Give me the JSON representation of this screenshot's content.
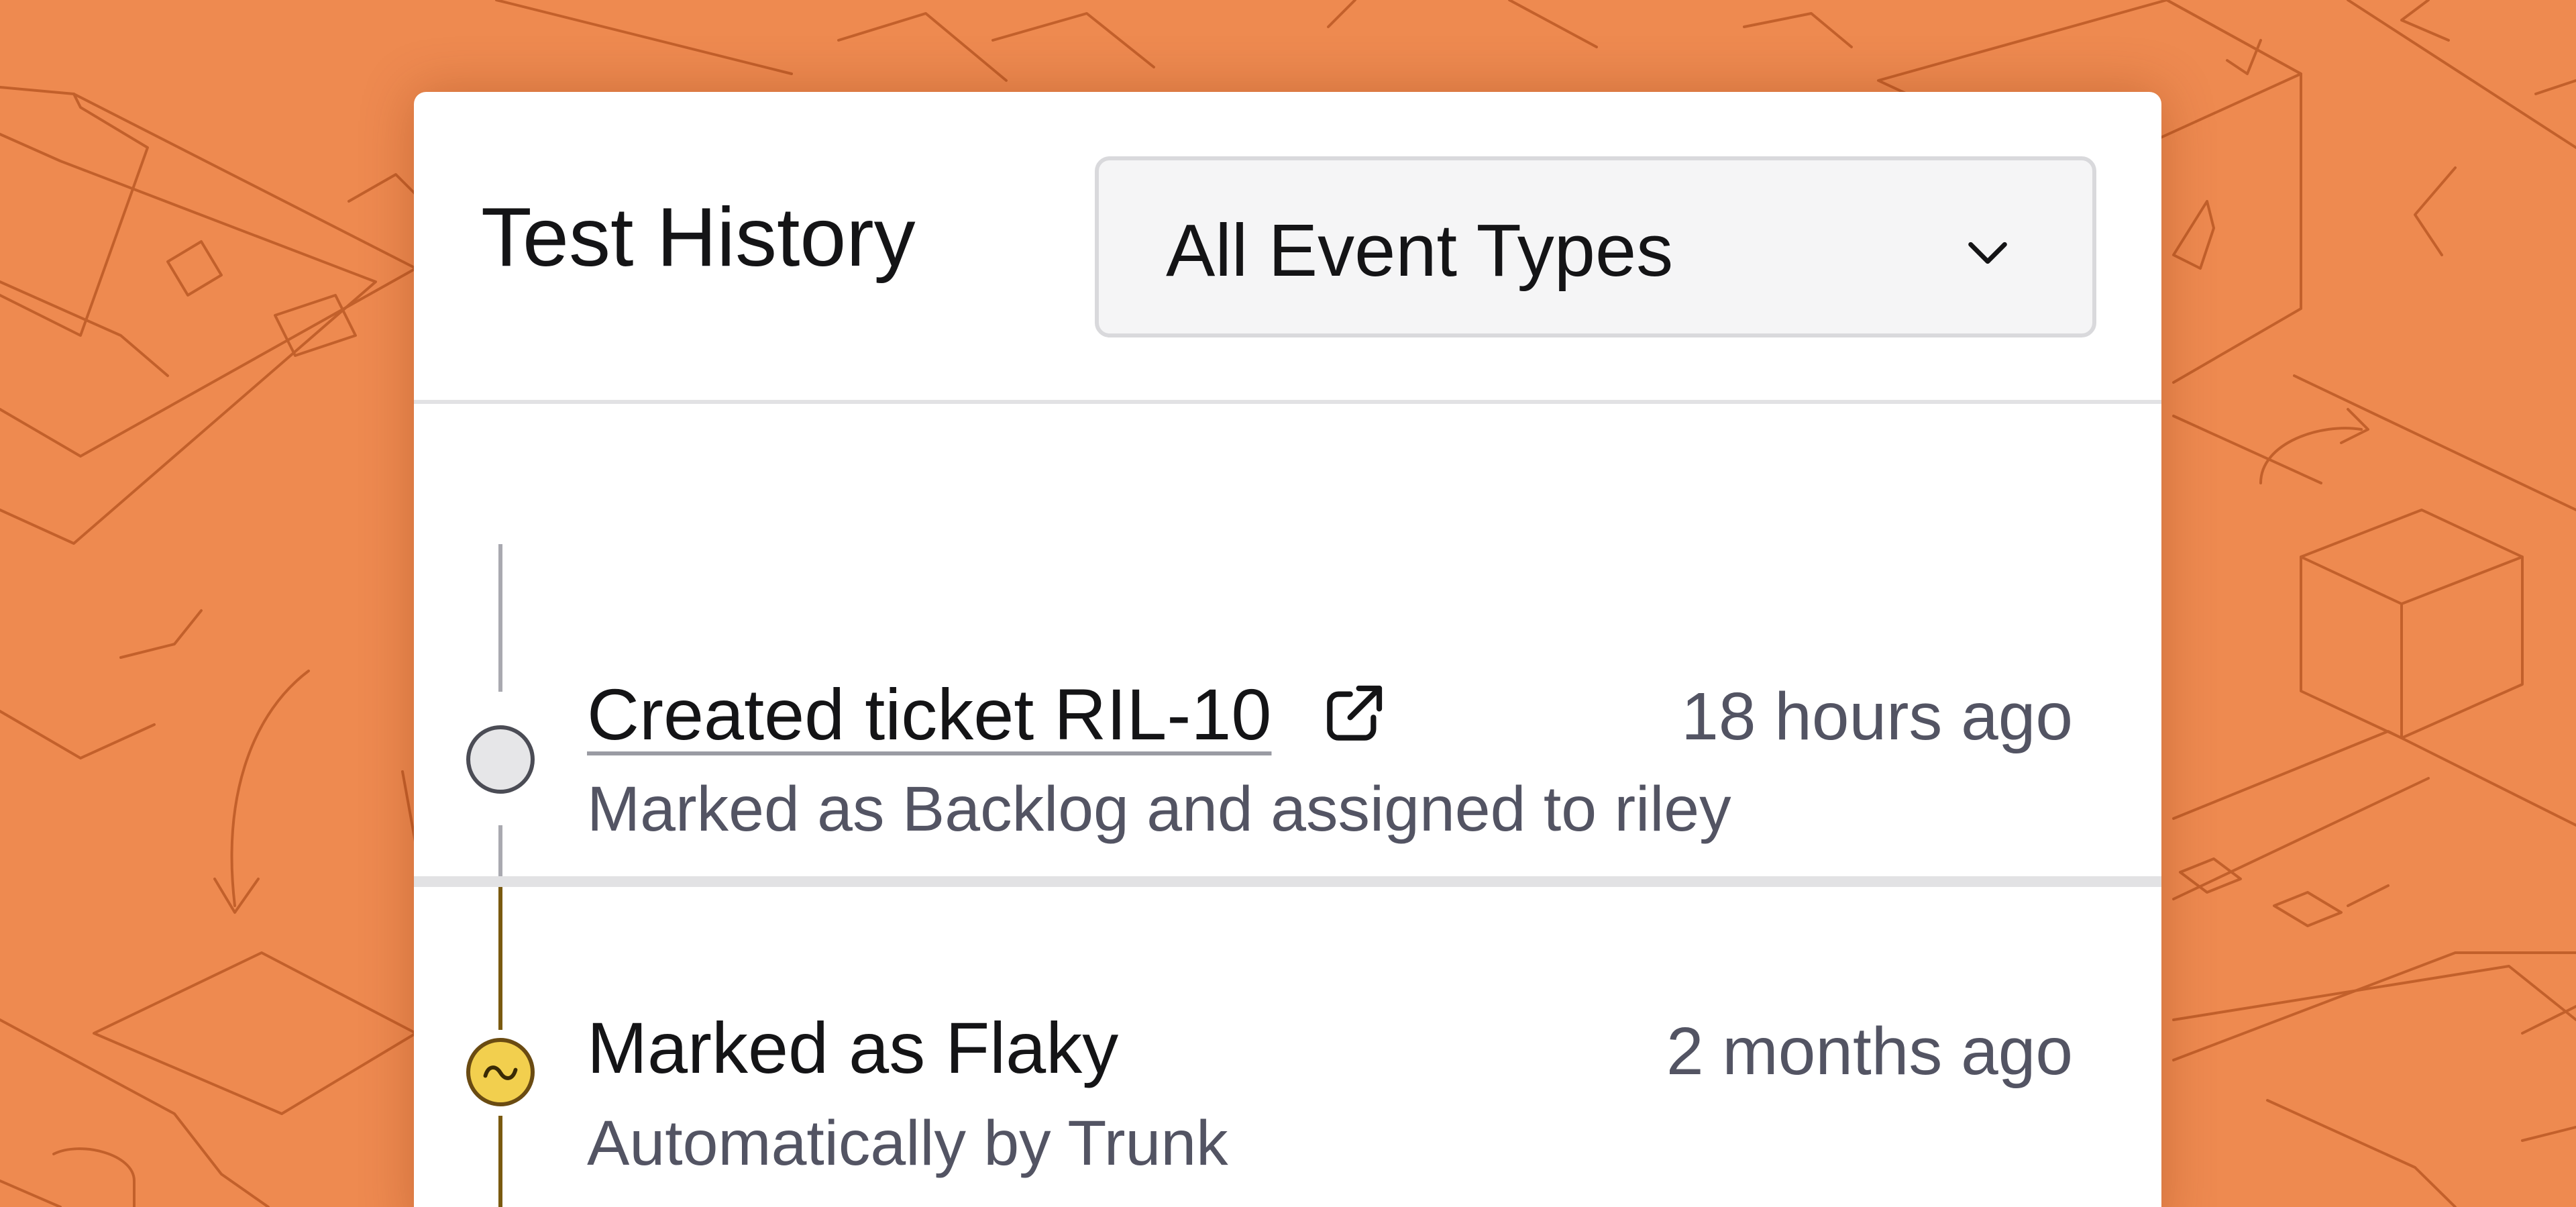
{
  "panel": {
    "title": "Test History"
  },
  "filter": {
    "selected": "All Event Types",
    "icon": "chevron-down-icon"
  },
  "events": [
    {
      "title": "Created ticket RIL-10",
      "link_icon": "external-link-icon",
      "time": "18 hours ago",
      "description": "Marked as Backlog and assigned to riley",
      "status": "neutral",
      "status_color": "#e6e6e8"
    },
    {
      "title": "Marked as Flaky",
      "time": "2 months ago",
      "description": "Automatically by Trunk",
      "status": "flaky",
      "status_icon": "flaky-wave-icon",
      "status_color": "#f2cf4e"
    }
  ],
  "colors": {
    "background": "#ee8a50",
    "panel": "#ffffff",
    "flaky_rail": "#7a5a10",
    "neutral_rail": "#a9a9b0"
  }
}
